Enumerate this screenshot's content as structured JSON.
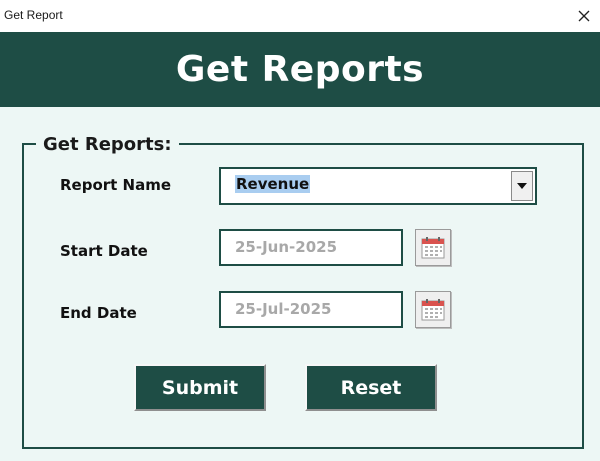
{
  "window": {
    "title": "Get Report",
    "close_icon": "close-icon"
  },
  "banner": {
    "heading": "Get Reports"
  },
  "form": {
    "group_title": "Get Reports:",
    "report_name_label": "Report Name",
    "report_name_value": "Revenue",
    "start_date_label": "Start Date",
    "start_date_value": "25-Jun-2025",
    "end_date_label": "End Date",
    "end_date_value": "25-Jul-2025",
    "calendar_icon": "calendar-icon"
  },
  "buttons": {
    "submit_label": "Submit",
    "reset_label": "Reset"
  },
  "colors": {
    "accent": "#1e4d45",
    "background": "#edf7f5",
    "selection": "#a9cdf0",
    "placeholder_text": "#a8a8a8"
  }
}
